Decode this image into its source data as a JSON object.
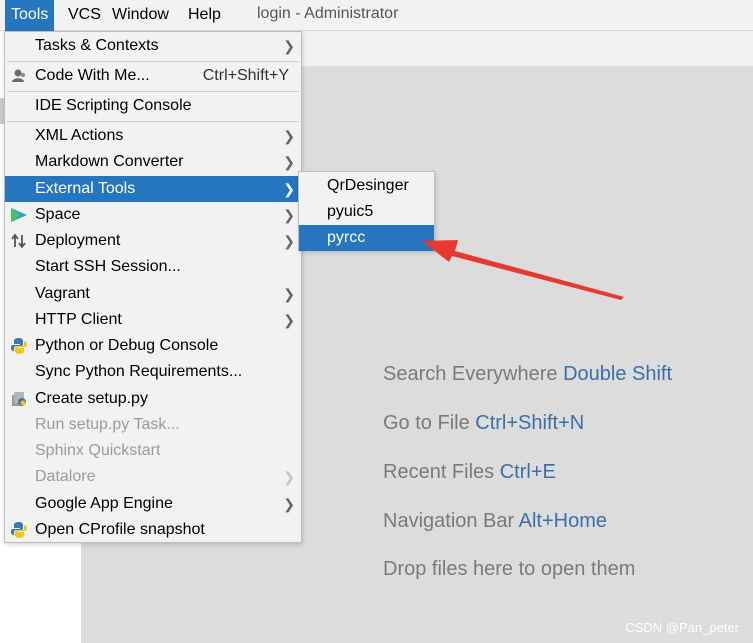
{
  "menubar": {
    "items": [
      {
        "label": "Tools"
      },
      {
        "label": "VCS"
      },
      {
        "label": "Window"
      },
      {
        "label": "Help"
      }
    ],
    "window_title": "login - Administrator"
  },
  "tools_menu": {
    "items": [
      {
        "label": "Tasks & Contexts",
        "submenu": true
      },
      {
        "label": "Code With Me...",
        "shortcut": "Ctrl+Shift+Y",
        "icon": "user-icon"
      },
      {
        "label": "IDE Scripting Console"
      },
      {
        "label": "XML Actions",
        "submenu": true
      },
      {
        "label": "Markdown Converter",
        "submenu": true
      },
      {
        "label": "External Tools",
        "submenu": true,
        "selected": true
      },
      {
        "label": "Space",
        "submenu": true,
        "icon": "space-icon"
      },
      {
        "label": "Deployment",
        "submenu": true,
        "icon": "deployment-icon"
      },
      {
        "label": "Start SSH Session..."
      },
      {
        "label": "Vagrant",
        "submenu": true
      },
      {
        "label": "HTTP Client",
        "submenu": true
      },
      {
        "label": "Python or Debug Console",
        "icon": "python-icon"
      },
      {
        "label": "Sync Python Requirements..."
      },
      {
        "label": "Create setup.py",
        "icon": "python-package-icon"
      },
      {
        "label": "Run setup.py Task...",
        "disabled": true
      },
      {
        "label": "Sphinx Quickstart",
        "disabled": true
      },
      {
        "label": "Datalore",
        "submenu": true,
        "disabled": true
      },
      {
        "label": "Google App Engine",
        "submenu": true
      },
      {
        "label": "Open CProfile snapshot",
        "icon": "python-profile-icon"
      }
    ]
  },
  "external_tools_submenu": {
    "items": [
      {
        "label": "QrDesinger"
      },
      {
        "label": "pyuic5"
      },
      {
        "label": "pyrcc",
        "selected": true
      }
    ]
  },
  "editor_hints": [
    {
      "text": "Search Everywhere",
      "shortcut": "Double Shift"
    },
    {
      "text": "Go to File",
      "shortcut": "Ctrl+Shift+N"
    },
    {
      "text": "Recent Files",
      "shortcut": "Ctrl+E"
    },
    {
      "text": "Navigation Bar",
      "shortcut": "Alt+Home"
    },
    {
      "text": "Drop files here to open them",
      "shortcut": ""
    }
  ],
  "watermark": "CSDN @Pan_peter",
  "colors": {
    "accent": "#2675bf",
    "shortcut_text": "#3a6fa8",
    "annotation_arrow": "#e8392f"
  }
}
